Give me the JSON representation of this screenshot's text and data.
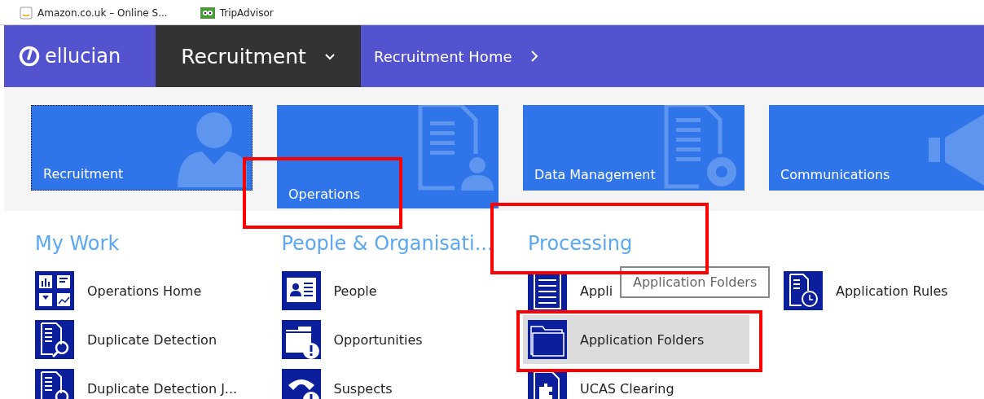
{
  "bookmarks": [
    {
      "label": "Amazon.co.uk – Online S...",
      "kind": "amazon"
    },
    {
      "label": "TripAdvisor",
      "kind": "trip"
    }
  ],
  "header": {
    "logo": "ellucian",
    "module": "Recruitment",
    "breadcrumb": "Recruitment Home"
  },
  "tiles": [
    {
      "label": "Recruitment",
      "kind": "person",
      "selected": true
    },
    {
      "label": "Operations",
      "kind": "document-person",
      "selected": false,
      "annotated": true
    },
    {
      "label": "Data Management",
      "kind": "document-gear",
      "selected": false
    },
    {
      "label": "Communications",
      "kind": "megaphone",
      "selected": false
    }
  ],
  "sections": [
    {
      "title": "My Work",
      "items": [
        {
          "label": "Operations Home",
          "kind": "dashboard",
          "selected": false
        },
        {
          "label": "Duplicate Detection",
          "kind": "doc-search",
          "selected": false
        },
        {
          "label": "Duplicate Detection J...",
          "kind": "doc-search",
          "selected": false
        }
      ]
    },
    {
      "title": "People & Organisati...",
      "items": [
        {
          "label": "People",
          "kind": "id-card",
          "selected": false
        },
        {
          "label": "Opportunities",
          "kind": "folder-alert",
          "selected": false
        },
        {
          "label": "Suspects",
          "kind": "phone-alert",
          "selected": false
        }
      ]
    },
    {
      "title": "Processing",
      "annotated": true,
      "items": [
        {
          "label": "Appli",
          "kind": "list",
          "selected": false,
          "tooltip": "Application Folders"
        },
        {
          "label": "Application Folders",
          "kind": "folder",
          "selected": true,
          "annotated": true
        },
        {
          "label": "UCAS Clearing",
          "kind": "doc-puzzle",
          "selected": false
        },
        {
          "label": "Application Rules",
          "kind": "doc-clock",
          "selected": false
        }
      ]
    }
  ]
}
